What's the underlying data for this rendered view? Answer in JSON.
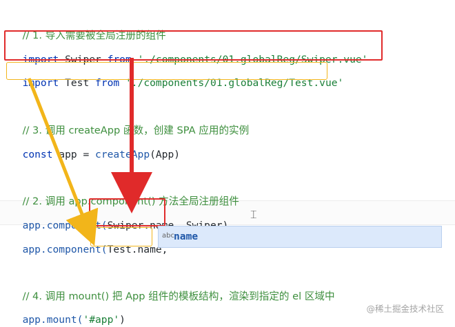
{
  "code": {
    "comment1": "// 1. 导入需要被全局注册的组件",
    "import1": {
      "kw": "import",
      "name": "Swiper",
      "from": "from",
      "path": "'./components/01.globalReg/Swiper.vue'"
    },
    "import2": {
      "kw": "import",
      "name": "Test",
      "from": "from",
      "path": "'./components/01.globalReg/Test.vue'"
    },
    "comment3": "// 3. 调用 createApp 函数，创建 SPA 应用的实例",
    "const_line": {
      "kw": "const",
      "rest_a": " app = ",
      "fn": "createApp",
      "rest_b": "(App)"
    },
    "comment2": "// 2. 调用 app.component() 方法全局注册组件",
    "component1": {
      "prefix": "app.component(",
      "arg": "Swiper.name,",
      "rest": " Swiper)"
    },
    "component2": {
      "prefix": "app.component(",
      "arg": "Test.name,",
      "rest": ""
    },
    "comment4": "// 4. 调用 mount() 把 App 组件的模板结构，渲染到指定的 el 区域中",
    "mount_line": {
      "prefix": "app.mount(",
      "str": "'#app'",
      "suffix": ")"
    }
  },
  "autocomplete": {
    "kind": "abc",
    "label": "name"
  },
  "watermark": "@稀土掘金技术社区",
  "colors": {
    "red_box": "#e02a2a",
    "yellow_box": "#f2b51a",
    "suggest_bg": "#dce9fb",
    "comment": "#3e8f3e"
  }
}
